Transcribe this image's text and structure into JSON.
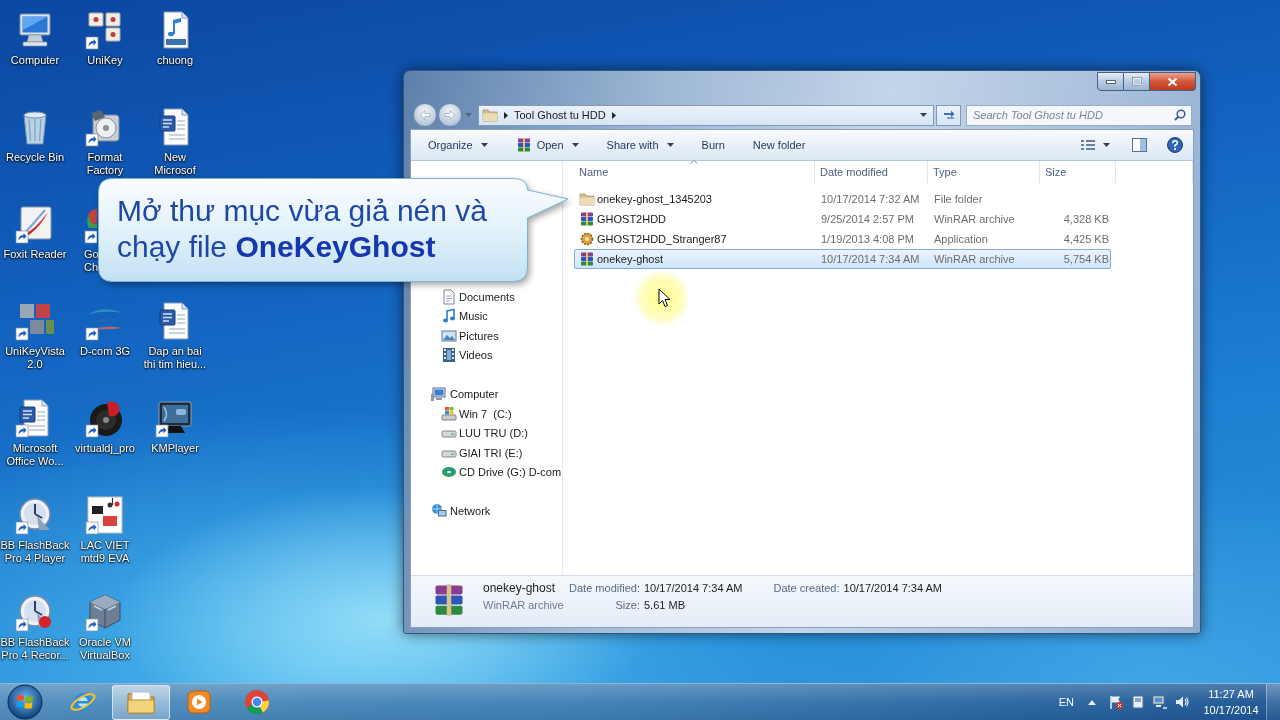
{
  "desktop": {
    "columns": [
      [
        {
          "label": "Computer",
          "kind": "computer",
          "shortcut": false
        },
        {
          "label": "Recycle Bin",
          "kind": "recycle-bin",
          "shortcut": false
        },
        {
          "label": "Foxit Reader",
          "kind": "pen-tile",
          "shortcut": true
        },
        {
          "label": "UniKeyVista\n2.0",
          "kind": "color-tiles",
          "shortcut": true
        },
        {
          "label": "Microsoft\nOffice Wo...",
          "kind": "document",
          "shortcut": true
        },
        {
          "label": "BB FlashBack\nPro 4 Player",
          "kind": "dial",
          "shortcut": true
        },
        {
          "label": "BB FlashBack\nPro 4 Recor...",
          "kind": "dial-record",
          "shortcut": true
        }
      ],
      [
        {
          "label": "UniKey",
          "kind": "key-tiles",
          "shortcut": true
        },
        {
          "label": "Format\nFactory",
          "kind": "disc-box",
          "shortcut": true
        },
        {
          "label": "Go\nCh",
          "kind": "covered",
          "shortcut": true
        },
        {
          "label": "D-com 3G",
          "kind": "swoosh",
          "shortcut": true
        },
        {
          "label": "virtualdj_pro",
          "kind": "vinyl",
          "shortcut": true
        },
        {
          "label": "LAC VIET\nmtd9 EVA",
          "kind": "notes-tile",
          "shortcut": true
        },
        {
          "label": "Oracle VM\nVirtualBox",
          "kind": "cube",
          "shortcut": true
        }
      ],
      [
        {
          "label": "chuong",
          "kind": "audio-file",
          "shortcut": false
        },
        {
          "label": "New\nMicrosof",
          "kind": "document",
          "shortcut": false
        },
        null,
        {
          "label": "Dap an bai\nthi tim hieu...",
          "kind": "document",
          "shortcut": false
        },
        {
          "label": "KMPlayer",
          "kind": "screen",
          "shortcut": true
        }
      ]
    ]
  },
  "callout": {
    "text": "Mở thư mục vừa giả nén và chạy file **OneKeyGhost**"
  },
  "explorer": {
    "address": {
      "path": [
        "Tool Ghost tu HDD"
      ]
    },
    "search": {
      "placeholder": "Search Tool Ghost tu HDD"
    },
    "toolbar": [
      {
        "label": "Organize",
        "kind": "plain",
        "dropdown": true
      },
      {
        "label": "Open",
        "kind": "archive",
        "dropdown": true
      },
      {
        "label": "Share with",
        "kind": "plain",
        "dropdown": true
      },
      {
        "label": "Burn",
        "kind": "plain",
        "dropdown": false
      },
      {
        "label": "New folder",
        "kind": "plain",
        "dropdown": false
      }
    ],
    "nav_pane": {
      "items": [
        {
          "children": [
            {
              "label": "Documents",
              "kind": "documents"
            },
            {
              "label": "Music",
              "kind": "music"
            },
            {
              "label": "Pictures",
              "kind": "pictures"
            },
            {
              "label": "Videos",
              "kind": "videos"
            }
          ]
        },
        {
          "label": "Computer",
          "kind": "computer",
          "children": [
            {
              "label": "Win 7  (C:)",
              "kind": "system-drive"
            },
            {
              "label": "LUU TRU (D:)",
              "kind": "drive"
            },
            {
              "label": "GIAI TRI (E:)",
              "kind": "drive"
            },
            {
              "label": "CD Drive (G:) D-com",
              "kind": "cd-drive"
            }
          ]
        },
        {
          "label": "Network",
          "kind": "network"
        }
      ]
    },
    "columns": [
      {
        "label": "Name",
        "sorted": true
      },
      {
        "label": "Date modified",
        "sorted": false
      },
      {
        "label": "Type",
        "sorted": false
      },
      {
        "label": "Size",
        "sorted": false
      }
    ],
    "files": [
      {
        "name": "onekey-ghost_1345203",
        "date": "10/17/2014 7:32 AM",
        "type": "File folder",
        "kind": "folder",
        "selected": false
      },
      {
        "name": "GHOST2HDD",
        "date": "9/25/2014 2:57 PM",
        "type": "WinRAR archive",
        "size": "4,328 KB",
        "kind": "archive",
        "selected": false
      },
      {
        "name": "GHOST2HDD_Stranger87",
        "date": "1/19/2013 4:08 PM",
        "type": "Application",
        "size": "4,425 KB",
        "kind": "application",
        "selected": false
      },
      {
        "name": "onekey-ghost",
        "date": "10/17/2014 7:34 AM",
        "type": "WinRAR archive",
        "size": "5,754 KB",
        "kind": "archive",
        "selected": true
      }
    ],
    "details_pane": {
      "kind": "archive",
      "name": "onekey-ghost",
      "type": "WinRAR archive",
      "fields": [
        {
          "label": "Date modified:",
          "value": "10/17/2014 7:34 AM"
        },
        {
          "label": "Size:",
          "value": "5.61 MB"
        },
        {
          "label": "Date created:",
          "value": "10/17/2014 7:34 AM"
        }
      ]
    }
  },
  "taskbar": {
    "apps": [
      {
        "kind": "globe",
        "active": false
      },
      {
        "kind": "folder",
        "active": true
      },
      {
        "kind": "media",
        "active": false
      },
      {
        "kind": "tricolor",
        "active": false
      }
    ],
    "language": "EN",
    "time": "11:27 AM",
    "date": "10/17/2014"
  }
}
